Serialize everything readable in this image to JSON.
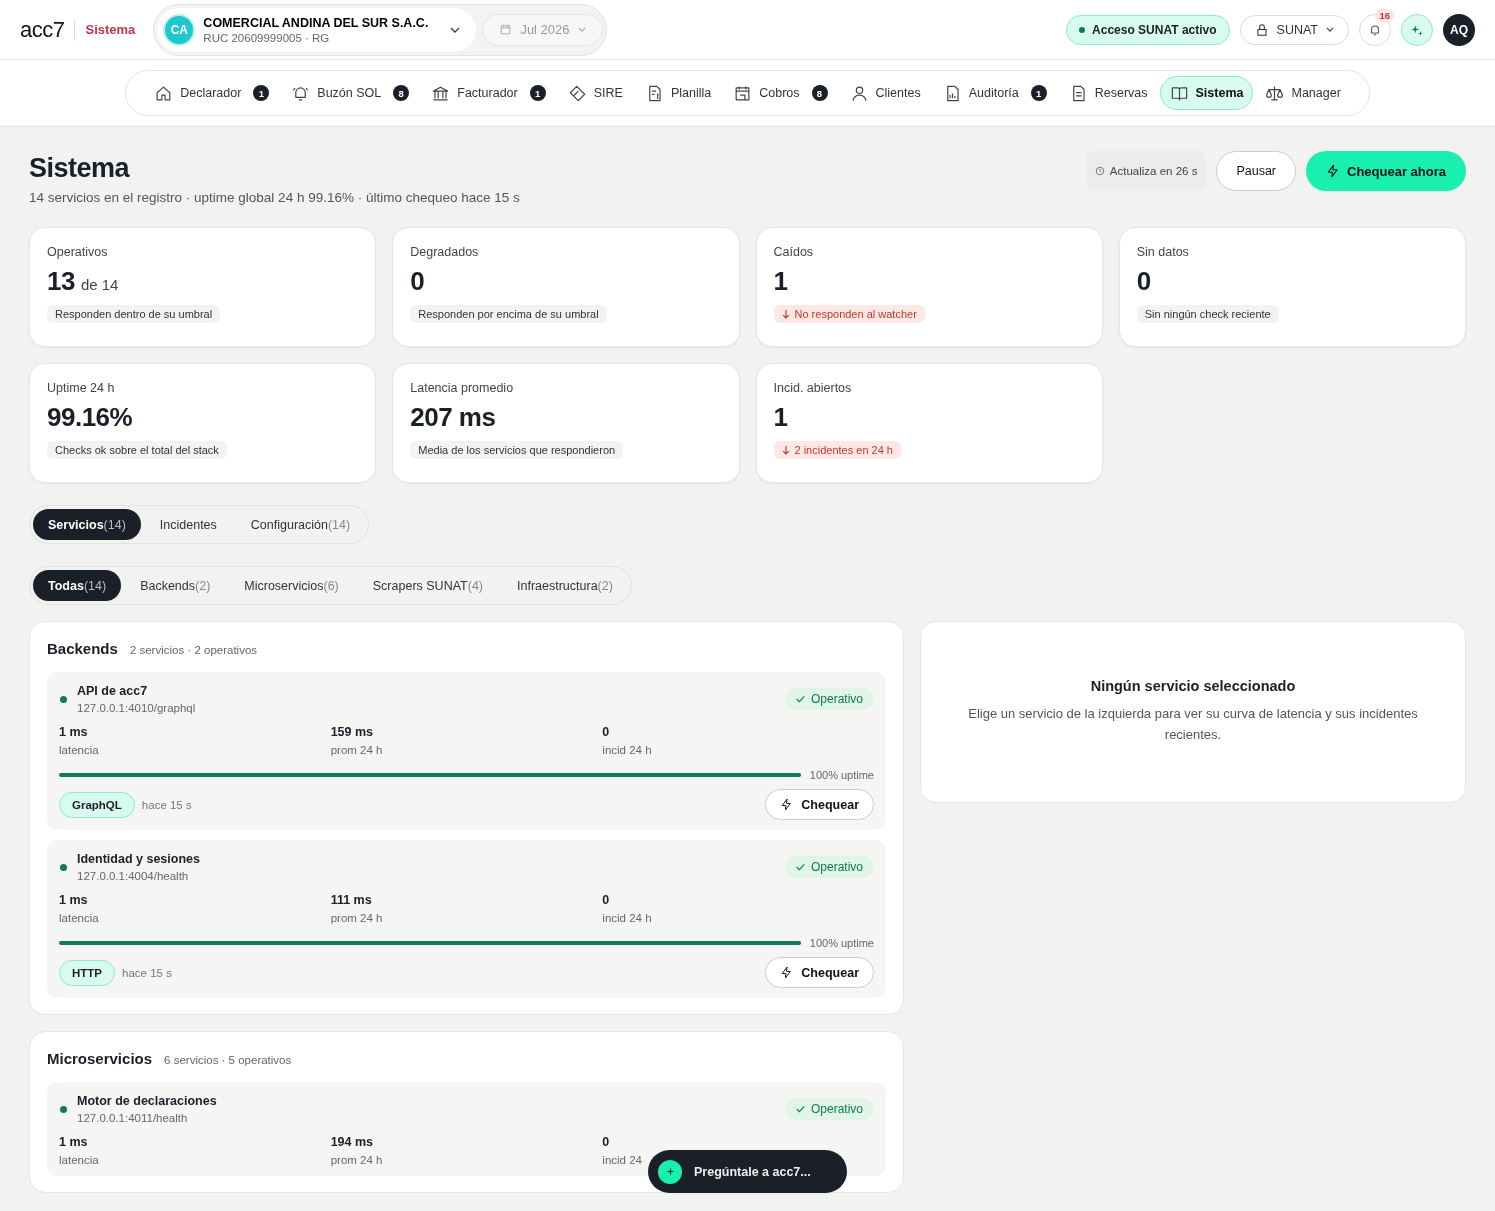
{
  "header": {
    "logo": "acc7",
    "section": "Sistema",
    "company": {
      "initials": "CA",
      "name": "COMERCIAL ANDINA DEL SUR S.A.C.",
      "ruc": "RUC 20609999005 · RG"
    },
    "period": "Jul 2026",
    "sunat_status": "Acceso SUNAT activo",
    "sunat_menu": "SUNAT",
    "notifications": "16",
    "avatar": "AQ"
  },
  "nav": [
    {
      "label": "Declarador",
      "badge": "1",
      "selected": false
    },
    {
      "label": "Buzón SOL",
      "badge": "8",
      "selected": false
    },
    {
      "label": "Facturador",
      "badge": "1",
      "selected": false
    },
    {
      "label": "SIRE",
      "selected": false
    },
    {
      "label": "Planilla",
      "selected": false
    },
    {
      "label": "Cobros",
      "badge": "8",
      "selected": false
    },
    {
      "label": "Clientes",
      "selected": false
    },
    {
      "label": "Auditoría",
      "badge": "1",
      "selected": false
    },
    {
      "label": "Reservas",
      "selected": false
    },
    {
      "label": "Sistema",
      "selected": true
    },
    {
      "label": "Manager",
      "selected": false
    }
  ],
  "page": {
    "title": "Sistema",
    "subtitle": "14 servicios en el registro · uptime global 24 h 99.16% · último chequeo hace 15 s",
    "refresh": "Actualiza en 26 s",
    "pause_button": "Pausar",
    "check_button": "Chequear ahora"
  },
  "stats": [
    {
      "label": "Operativos",
      "value": "13",
      "suffix": "de 14",
      "note": "Responden dentro de su umbral",
      "kind": "neutral"
    },
    {
      "label": "Degradados",
      "value": "0",
      "note": "Responden por encima de su umbral",
      "kind": "neutral"
    },
    {
      "label": "Caídos",
      "value": "1",
      "note": "No responden al watcher",
      "kind": "alert"
    },
    {
      "label": "Sin datos",
      "value": "0",
      "note": "Sin ningún check reciente",
      "kind": "neutral"
    },
    {
      "label": "Uptime 24 h",
      "value": "99.16%",
      "note": "Checks ok sobre el total del stack",
      "kind": "neutral"
    },
    {
      "label": "Latencia promedio",
      "value": "207 ms",
      "note": "Media de los servicios que respondieron",
      "kind": "neutral"
    },
    {
      "label": "Incid. abiertos",
      "value": "1",
      "note": "2 incidentes en 24 h",
      "kind": "alert"
    }
  ],
  "tabs": [
    {
      "label": "Servicios",
      "count": "(14)",
      "selected": true
    },
    {
      "label": "Incidentes",
      "selected": false
    },
    {
      "label": "Configuración",
      "count": "(14)",
      "selected": false
    }
  ],
  "filters": [
    {
      "label": "Todas",
      "count": "(14)",
      "selected": true
    },
    {
      "label": "Backends",
      "count": "(2)",
      "selected": false
    },
    {
      "label": "Microservicios",
      "count": "(6)",
      "selected": false
    },
    {
      "label": "Scrapers SUNAT",
      "count": "(4)",
      "selected": false
    },
    {
      "label": "Infraestructura",
      "count": "(2)",
      "selected": false
    }
  ],
  "groups": [
    {
      "name": "Backends",
      "summary": "2 servicios · 2 operativos",
      "services": [
        {
          "name": "API de acc7",
          "url": "127.0.0.1:4010/graphql",
          "color": "#0f7a55",
          "status": "Operativo",
          "kind": "ok",
          "metrics": [
            {
              "value": "1 ms",
              "label": "latencia"
            },
            {
              "value": "159 ms",
              "label": "prom 24 h"
            },
            {
              "value": "0",
              "label": "incid 24 h"
            }
          ],
          "level": 1,
          "uptime": "100% uptime",
          "protocol": "GraphQL",
          "ago": "hace 15 s",
          "check_button": "Chequear"
        },
        {
          "name": "Identidad y sesiones",
          "url": "127.0.0.1:4004/health",
          "color": "#0f7a55",
          "status": "Operativo",
          "kind": "ok",
          "metrics": [
            {
              "value": "1 ms",
              "label": "latencia"
            },
            {
              "value": "111 ms",
              "label": "prom 24 h"
            },
            {
              "value": "0",
              "label": "incid 24 h"
            }
          ],
          "level": 1,
          "uptime": "100% uptime",
          "protocol": "HTTP",
          "ago": "hace 15 s",
          "check_button": "Chequear"
        }
      ]
    },
    {
      "name": "Microservicios",
      "summary": "6 servicios · 5 operativos",
      "services": [
        {
          "name": "Motor de declaraciones",
          "url": "127.0.0.1:4011/health",
          "color": "#0f7a55",
          "status": "Operativo",
          "kind": "ok",
          "metrics": [
            {
              "value": "1 ms",
              "label": "latencia"
            },
            {
              "value": "194 ms",
              "label": "prom 24 h"
            },
            {
              "value": "0",
              "label": "incid 24"
            }
          ]
        }
      ]
    }
  ],
  "detail": {
    "title": "Ningún servicio seleccionado",
    "text": "Elige un servicio de la izquierda para ver su curva de latencia y sus incidentes recientes."
  },
  "assistant": "Pregúntale a acc7..."
}
